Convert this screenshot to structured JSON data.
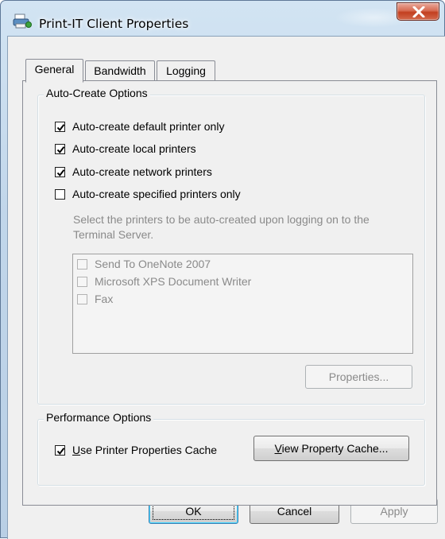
{
  "window": {
    "title": "Print-IT Client Properties",
    "close_label": "X"
  },
  "tabs": [
    {
      "label": "General",
      "active": true
    },
    {
      "label": "Bandwidth",
      "active": false
    },
    {
      "label": "Logging",
      "active": false
    }
  ],
  "auto_create": {
    "group_title": "Auto-Create Options",
    "options": [
      {
        "label": "Auto-create default printer only",
        "checked": true
      },
      {
        "label": "Auto-create local printers",
        "checked": true
      },
      {
        "label": "Auto-create network printers",
        "checked": true
      },
      {
        "label": "Auto-create specified printers only",
        "checked": false
      }
    ],
    "hint_line1": "Select the printers to be auto-created upon logging on to the",
    "hint_line2": "Terminal Server.",
    "printers": [
      {
        "name": "Send To OneNote 2007",
        "checked": false
      },
      {
        "name": "Microsoft XPS Document Writer",
        "checked": false
      },
      {
        "name": "Fax",
        "checked": false
      }
    ],
    "properties_button": "Properties..."
  },
  "performance": {
    "group_title": "Performance Options",
    "cache_label_accel": "U",
    "cache_label_rest": "se Printer Properties Cache",
    "cache_checked": true,
    "view_cache_accel": "V",
    "view_cache_rest": "iew Property Cache..."
  },
  "footer": {
    "ok": "OK",
    "cancel": "Cancel",
    "apply": "Apply"
  },
  "colors": {
    "title_bar": "#c1d6ea",
    "close_button": "#c94a2e",
    "dialog_bg": "#f0f0f0",
    "disabled_text": "#8a8a8a"
  }
}
